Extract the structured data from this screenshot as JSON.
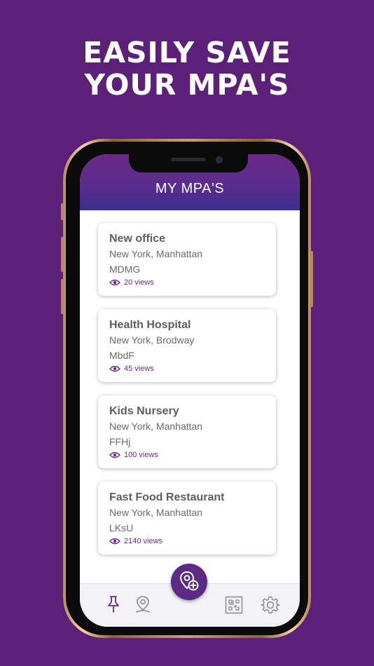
{
  "headline": {
    "line1": "EASILY SAVE",
    "line2": "YOUR MPA'S"
  },
  "app": {
    "title": "MY MPA'S",
    "cards": [
      {
        "title": "New office",
        "location": "New York, Manhattan",
        "code": "MDMG",
        "views": "20 views"
      },
      {
        "title": "Health Hospital",
        "location": "New York, Brodway",
        "code": "MbdF",
        "views": "45 views"
      },
      {
        "title": "Kids Nursery",
        "location": "New York, Manhattan",
        "code": "FFHj",
        "views": "100 views"
      },
      {
        "title": "Fast Food Restaurant",
        "location": "New York, Manhattan",
        "code": "LKsU",
        "views": "2140 views"
      }
    ],
    "tabbar": {
      "icons": [
        "pin-icon",
        "location-icon",
        "add-location-icon",
        "qr-scan-icon",
        "settings-icon"
      ]
    }
  },
  "colors": {
    "background": "#5b2178",
    "header_top": "#6a2a84",
    "header_bottom": "#3b2f8f",
    "accent": "#6b2a88",
    "fab": "#5a2a84"
  }
}
